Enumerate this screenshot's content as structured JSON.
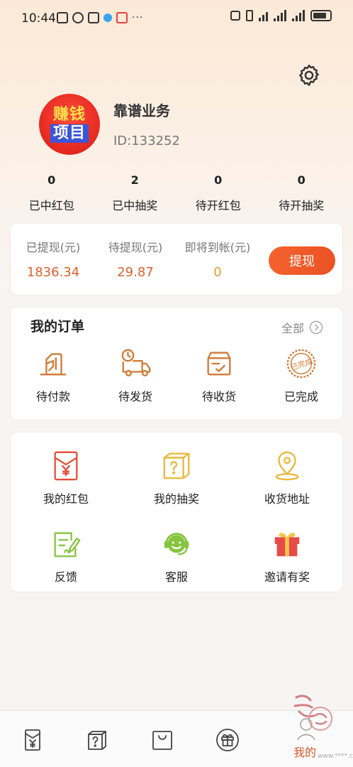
{
  "status_bar": {
    "time": "10:44"
  },
  "profile": {
    "avatar_line1": "赚钱",
    "avatar_line2": "项目",
    "name": "靠谱业务",
    "id_text": "ID:133252"
  },
  "stats": [
    {
      "value": "0",
      "label": "已中红包"
    },
    {
      "value": "2",
      "label": "已中抽奖"
    },
    {
      "value": "0",
      "label": "待开红包"
    },
    {
      "value": "0",
      "label": "待开抽奖"
    }
  ],
  "wallet": {
    "withdrawn_label": "已提现(元)",
    "withdrawn_value": "1836.34",
    "pending_label": "待提现(元)",
    "pending_value": "29.87",
    "incoming_label": "即将到帐(元)",
    "incoming_value": "0",
    "withdraw_button": "提现"
  },
  "orders": {
    "title": "我的订单",
    "all_label": "全部",
    "items": [
      {
        "label": "待付款",
        "icon": "payment-icon"
      },
      {
        "label": "待发货",
        "icon": "delivery-truck-icon"
      },
      {
        "label": "待收货",
        "icon": "package-box-icon"
      },
      {
        "label": "已完成",
        "icon": "completed-stamp-icon"
      }
    ],
    "stamp_text": "已完成"
  },
  "services": [
    {
      "label": "我的红包",
      "icon": "red-envelope-icon"
    },
    {
      "label": "我的抽奖",
      "icon": "mystery-box-icon"
    },
    {
      "label": "收货地址",
      "icon": "location-pin-icon"
    },
    {
      "label": "反馈",
      "icon": "feedback-icon"
    },
    {
      "label": "客服",
      "icon": "customer-service-icon"
    },
    {
      "label": "邀请有奖",
      "icon": "gift-icon"
    }
  ],
  "tabbar": {
    "active_label": "我的",
    "watermark_text": "www.****.cn"
  },
  "colors": {
    "accent": "#ea5a28",
    "withdrawn_value": "#e0602c",
    "pending_value": "#e0602c",
    "incoming_value": "#e0a030",
    "icon_orange": "#d9833a",
    "icon_red": "#e0503a",
    "icon_green": "#86c440",
    "icon_yellow": "#e9b83a"
  }
}
